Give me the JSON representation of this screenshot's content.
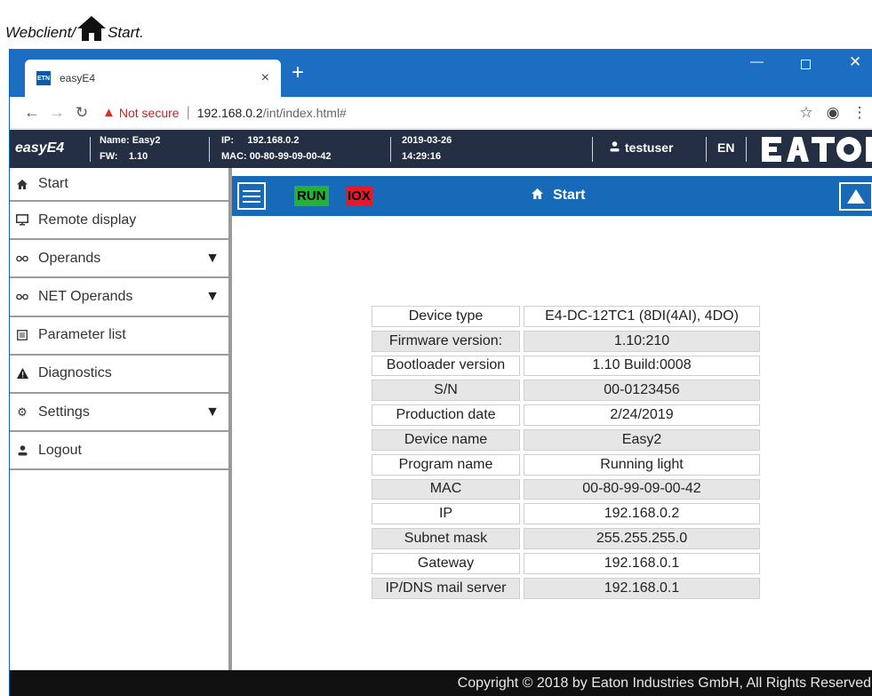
{
  "caption": {
    "prefix": "Webclient/",
    "suffix": " Start."
  },
  "browser": {
    "tab_title": "easyE4",
    "favicon_text": "ETN",
    "tab_close": "×",
    "new_tab": "+",
    "not_secure_label": "Not secure",
    "url_host": "192.168.0.2",
    "url_path": "/int/index.html#",
    "window_controls": {
      "minimize": "—",
      "close": "✕"
    }
  },
  "header": {
    "brand": "easyE4",
    "name_label": "Name:",
    "name_value": "Easy2",
    "fw_label": "FW:",
    "fw_value": "1.10",
    "ip_label": "IP:",
    "ip_value": "192.168.0.2",
    "mac_label": "MAC:",
    "mac_value": "00-80-99-09-00-42",
    "date": "2019-03-26",
    "time": "14:29:16",
    "user": "testuser",
    "lang": "EN"
  },
  "sidebar": {
    "items": [
      {
        "label": "Start",
        "icon": "home-icon"
      },
      {
        "label": "Remote display",
        "icon": "monitor-icon"
      },
      {
        "label": "Operands",
        "icon": "glasses-icon",
        "expandable": true
      },
      {
        "label": "NET Operands",
        "icon": "glasses-icon",
        "expandable": true
      },
      {
        "label": "Parameter list",
        "icon": "list-icon"
      },
      {
        "label": "Diagnostics",
        "icon": "warning-icon"
      },
      {
        "label": "Settings",
        "icon": "gear-icon",
        "expandable": true
      },
      {
        "label": "Logout",
        "icon": "user-icon"
      }
    ]
  },
  "toolbar": {
    "run_label": "RUN",
    "iox_label": "IOX",
    "breadcrumb": "Start",
    "colors": {
      "bar": "#176ab8",
      "run": "#24b236",
      "iox": "#e8182b"
    }
  },
  "device_info": [
    {
      "label": "Device type",
      "value": "E4-DC-12TC1 (8DI(4AI), 4DO)"
    },
    {
      "label": "Firmware version:",
      "value": "1.10:210"
    },
    {
      "label": "Bootloader version",
      "value": "1.10 Build:0008"
    },
    {
      "label": "S/N",
      "value": "00-0123456"
    },
    {
      "label": "Production date",
      "value": "2/24/2019"
    },
    {
      "label": "Device name",
      "value": "Easy2"
    },
    {
      "label": "Program name",
      "value": "Running light"
    },
    {
      "label": "MAC",
      "value": "00-80-99-09-00-42"
    },
    {
      "label": "IP",
      "value": "192.168.0.2"
    },
    {
      "label": "Subnet mask",
      "value": "255.255.255.0"
    },
    {
      "label": "Gateway",
      "value": "192.168.0.1"
    },
    {
      "label": "IP/DNS mail server",
      "value": "192.168.0.1"
    }
  ],
  "footer": "Copyright © 2018 by Eaton Industries GmbH, All Rights Reserved"
}
